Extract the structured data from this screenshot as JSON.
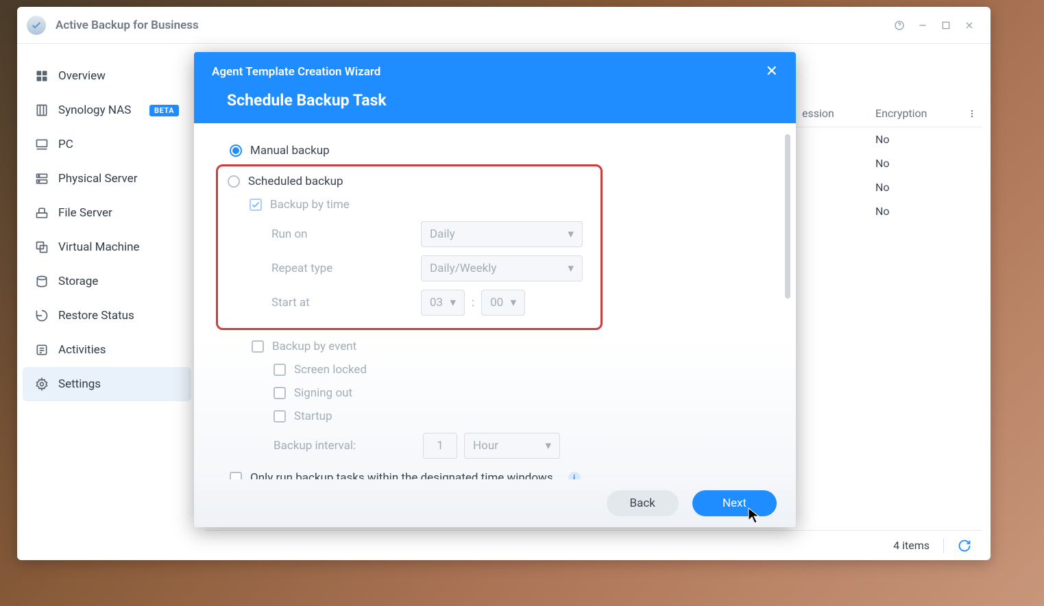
{
  "window": {
    "title": "Active Backup for Business"
  },
  "sidebar": {
    "items": [
      {
        "label": "Overview"
      },
      {
        "label": "Synology NAS",
        "badge": "BETA"
      },
      {
        "label": "PC"
      },
      {
        "label": "Physical Server"
      },
      {
        "label": "File Server"
      },
      {
        "label": "Virtual Machine"
      },
      {
        "label": "Storage"
      },
      {
        "label": "Restore Status"
      },
      {
        "label": "Activities"
      },
      {
        "label": "Settings"
      }
    ],
    "active_index": 9
  },
  "table": {
    "headers": {
      "col1": "ession",
      "col2": "Encryption"
    },
    "rows": [
      {
        "col2": "No"
      },
      {
        "col2": "No"
      },
      {
        "col2": "No"
      },
      {
        "col2": "No"
      }
    ],
    "footer_count": "4 items"
  },
  "modal": {
    "title": "Agent Template Creation Wizard",
    "subtitle": "Schedule Backup Task",
    "radio_manual": "Manual backup",
    "radio_scheduled": "Scheduled backup",
    "backup_by_time": "Backup by time",
    "run_on_label": "Run on",
    "run_on_value": "Daily",
    "repeat_label": "Repeat type",
    "repeat_value": "Daily/Weekly",
    "start_at_label": "Start at",
    "start_hour": "03",
    "start_minute": "00",
    "backup_by_event": "Backup by event",
    "event_screen": "Screen locked",
    "event_signout": "Signing out",
    "event_startup": "Startup",
    "interval_label": "Backup interval:",
    "interval_value": "1",
    "interval_unit": "Hour",
    "only_run_label": "Only run backup tasks within the designated time windows",
    "back_label": "Back",
    "next_label": "Next"
  }
}
